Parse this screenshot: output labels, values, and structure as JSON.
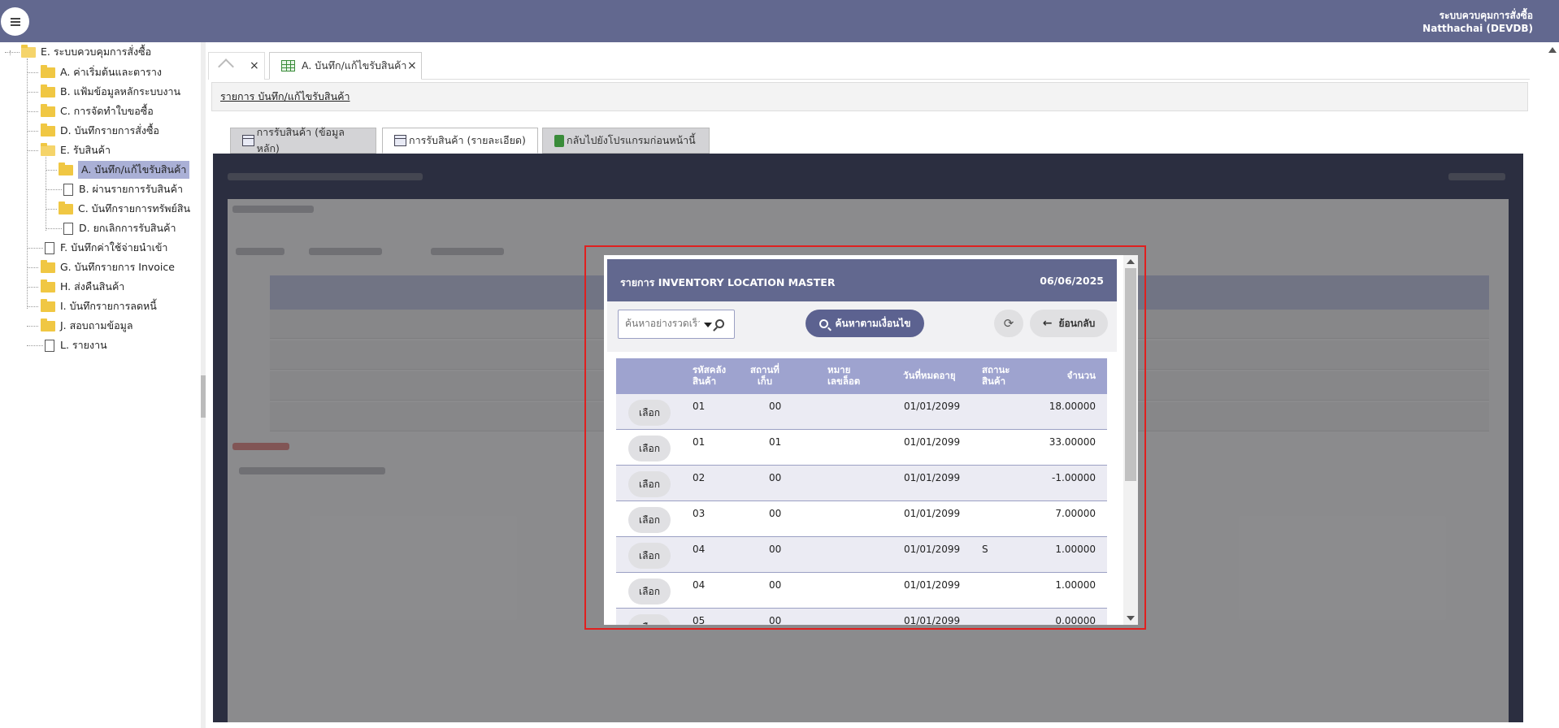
{
  "header": {
    "system_name": "ระบบควบคุมการสั่งซื้อ",
    "user": "Natthachai (DEVDB)"
  },
  "sidebar": {
    "root": "E. ระบบควบคุมการสั่งซื้อ",
    "items": [
      {
        "label": "A. ค่าเริ่มต้นและตาราง"
      },
      {
        "label": "B. แฟ้มข้อมูลหลักระบบงาน"
      },
      {
        "label": "C. การจัดทำใบขอซื้อ"
      },
      {
        "label": "D. บันทึกรายการสั่งซื้อ"
      },
      {
        "label": "E. รับสินค้า"
      },
      {
        "label": "A. บันทึก/แก้ไขรับสินค้า"
      },
      {
        "label": "B. ผ่านรายการรับสินค้า"
      },
      {
        "label": "C. บันทึกรายการทรัพย์สิน"
      },
      {
        "label": "D. ยกเลิกการรับสินค้า"
      },
      {
        "label": "F. บันทึกค่าใช้จ่ายนำเข้า"
      },
      {
        "label": "G. บันทึกรายการ Invoice"
      },
      {
        "label": "H. ส่งคืนสินค้า"
      },
      {
        "label": "I. บันทึกรายการลดหนี้"
      },
      {
        "label": "J. สอบถามข้อมูล"
      },
      {
        "label": "L. รายงาน"
      }
    ]
  },
  "tabs": {
    "main_tab": "A. บันทึก/แก้ไขรับสินค้า",
    "close": "×"
  },
  "breadcrumb": "รายการ บันทึก/แก้ไขรับสินค้า",
  "subtabs": [
    {
      "label": "การรับสินค้า (ข้อมูลหลัก)"
    },
    {
      "label": "การรับสินค้า (รายละเอียด)"
    },
    {
      "label": "กลับไปยังโปรแกรมก่อนหน้านี้"
    }
  ],
  "modal": {
    "title": "รายการ INVENTORY LOCATION MASTER",
    "date": "06/06/2025",
    "search_placeholder": "ค้นหาอย่างรวดเร็ว",
    "advanced_search": "ค้นหาตามเงื่อนไข",
    "back": "ย้อนกลับ",
    "columns": {
      "wh_l1": "รหัสคลัง",
      "wh_l2": "สินค้า",
      "loc_l1": "สถานที่",
      "loc_l2": "เก็บ",
      "lot_l1": "หมาย",
      "lot_l2": "เลขล็อต",
      "exp": "วันที่หมดอายุ",
      "st_l1": "สถานะ",
      "st_l2": "สินค้า",
      "qty": "จำนวน"
    },
    "rows": [
      {
        "btn": "เลือก",
        "wh": "01",
        "loc": "00",
        "lot": "",
        "exp": "01/01/2099",
        "status": "",
        "qty": "18.00000"
      },
      {
        "btn": "เลือก",
        "wh": "01",
        "loc": "01",
        "lot": "",
        "exp": "01/01/2099",
        "status": "",
        "qty": "33.00000"
      },
      {
        "btn": "เลือก",
        "wh": "02",
        "loc": "00",
        "lot": "",
        "exp": "01/01/2099",
        "status": "",
        "qty": "-1.00000"
      },
      {
        "btn": "เลือก",
        "wh": "03",
        "loc": "00",
        "lot": "",
        "exp": "01/01/2099",
        "status": "",
        "qty": "7.00000"
      },
      {
        "btn": "เลือก",
        "wh": "04",
        "loc": "00",
        "lot": "",
        "exp": "01/01/2099",
        "status": "S",
        "qty": "1.00000"
      },
      {
        "btn": "เลือก",
        "wh": "04",
        "loc": "00",
        "lot": "",
        "exp": "01/01/2099",
        "status": "",
        "qty": "1.00000"
      },
      {
        "btn": "เลือก",
        "wh": "05",
        "loc": "00",
        "lot": "",
        "exp": "01/01/2099",
        "status": "",
        "qty": "0.00000"
      }
    ]
  },
  "colors": {
    "header_bg": "#62688f",
    "accent_button": "#5c6290",
    "table_header": "#9ea3cf",
    "highlight_frame": "#e0201f"
  }
}
